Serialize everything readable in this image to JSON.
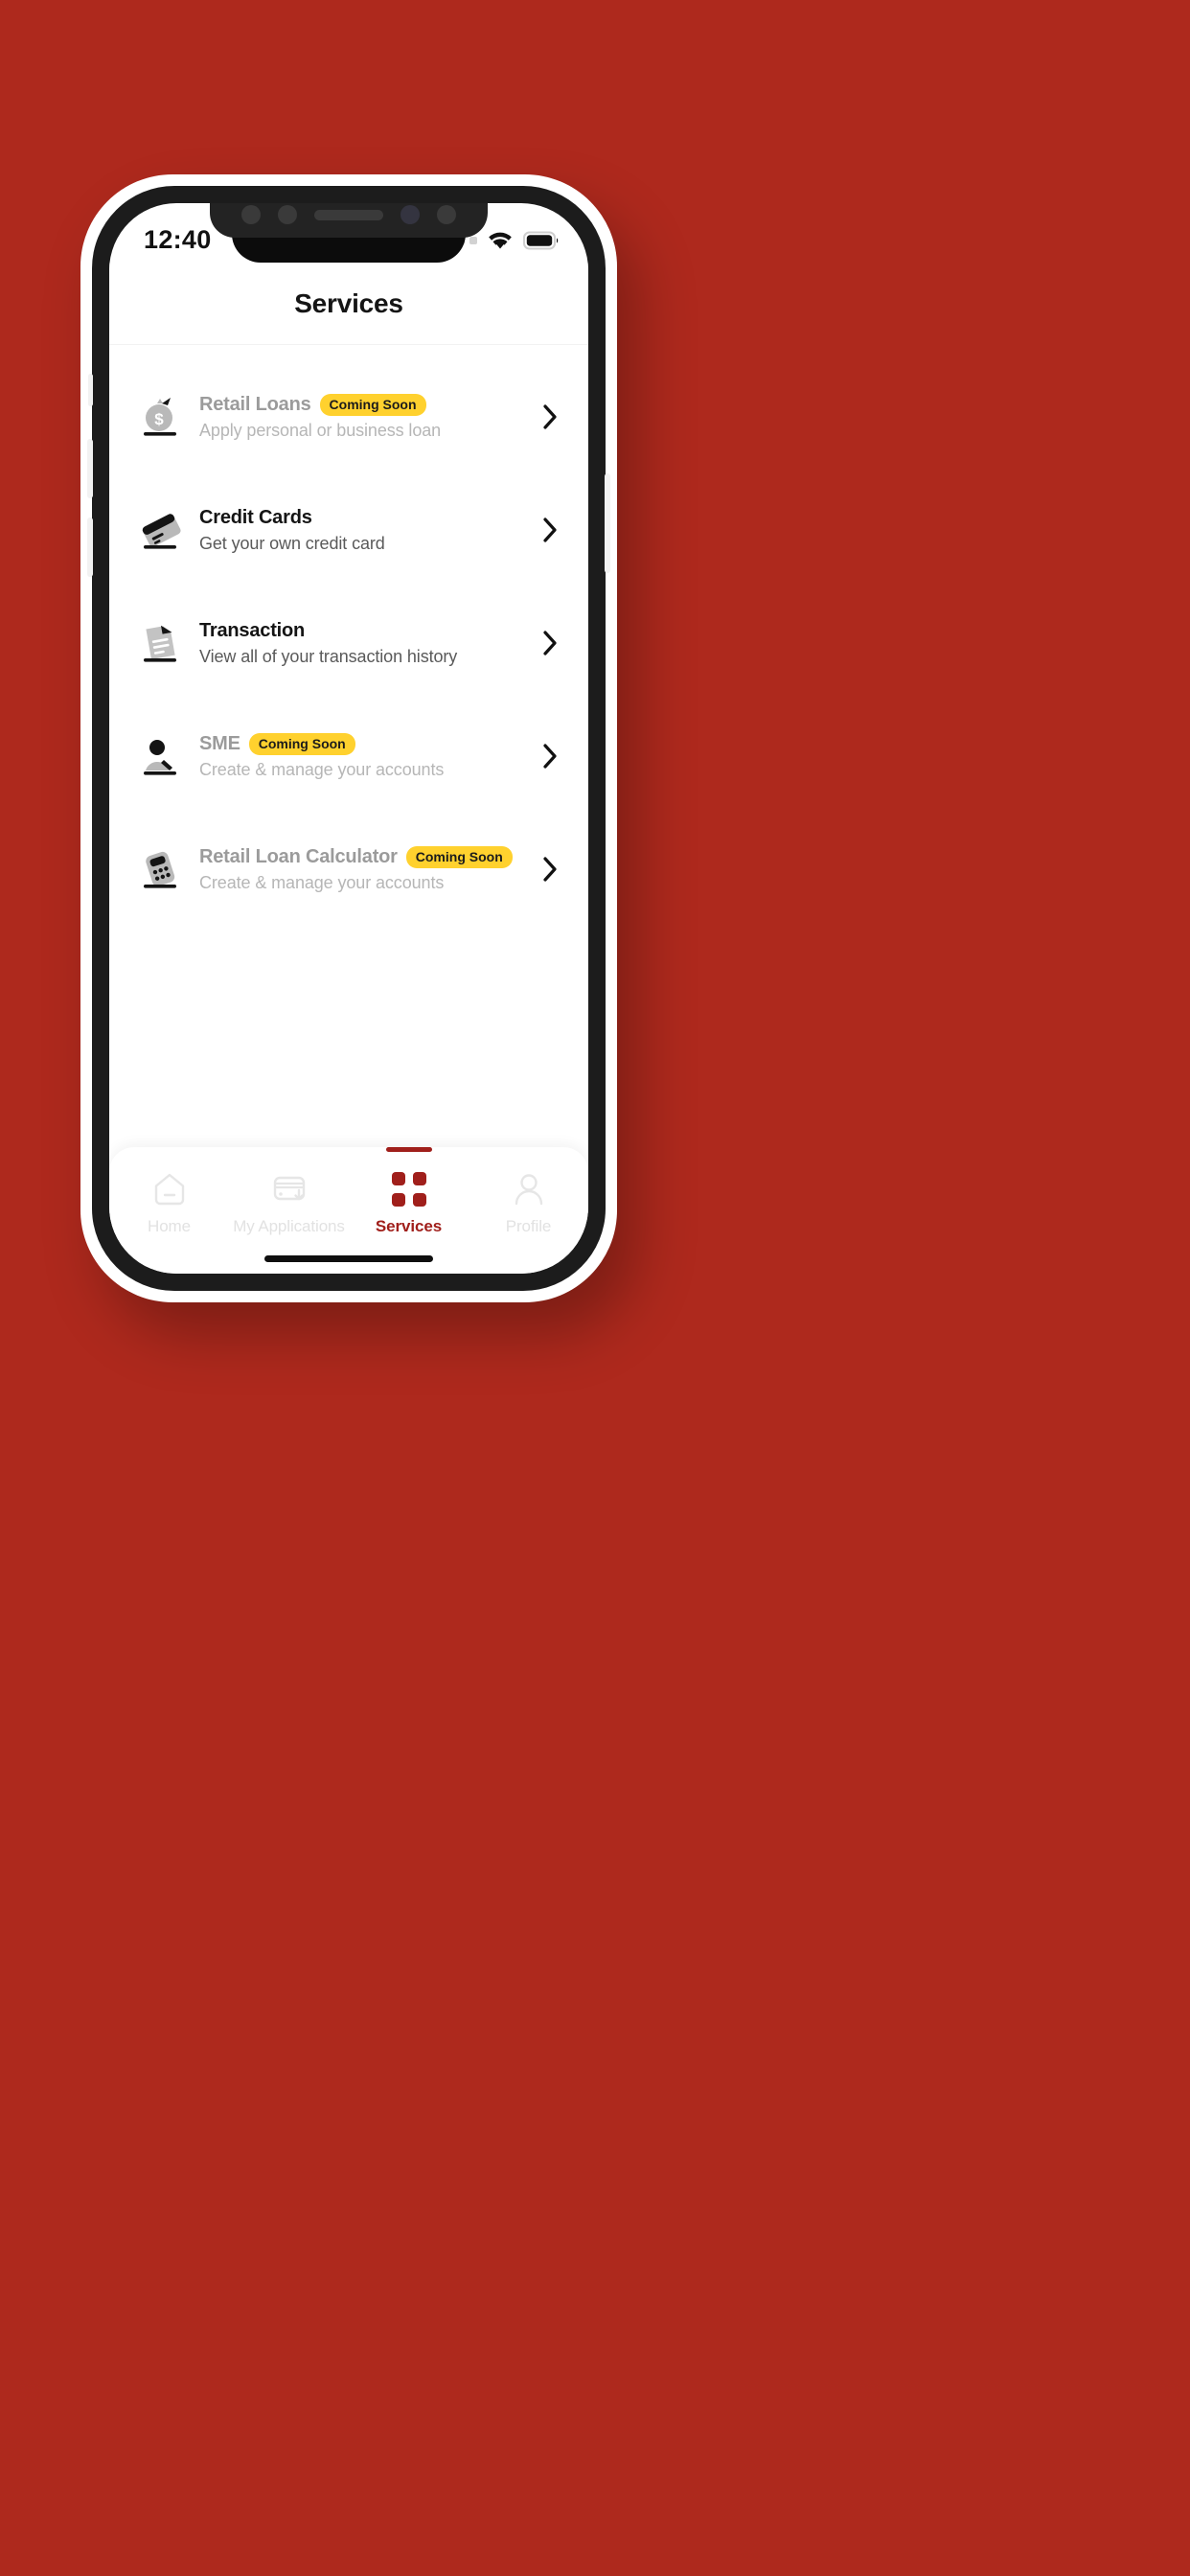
{
  "theme": {
    "background_red": "#AE291D",
    "brand_red": "#A01F1B",
    "badge_yellow": "#FFD12E",
    "muted_text": "#9b9b9b"
  },
  "status_bar": {
    "time": "12:40",
    "signal_icon": "signal-dots-icon",
    "wifi_icon": "wifi-icon",
    "battery_icon": "battery-full-icon"
  },
  "header": {
    "title": "Services"
  },
  "services": [
    {
      "icon": "money-bag-icon",
      "title": "Retail Loans",
      "badge": "Coming Soon",
      "subtitle": "Apply personal or business loan",
      "disabled": true,
      "chevron": "chevron-right-icon"
    },
    {
      "icon": "credit-card-icon",
      "title": "Credit Cards",
      "badge": "",
      "subtitle": "Get your own credit card",
      "disabled": false,
      "chevron": "chevron-right-icon"
    },
    {
      "icon": "document-icon",
      "title": "Transaction",
      "badge": "",
      "subtitle": "View all of your transaction history",
      "disabled": false,
      "chevron": "chevron-right-icon"
    },
    {
      "icon": "person-desk-icon",
      "title": "SME",
      "badge": "Coming Soon",
      "subtitle": "Create & manage your accounts",
      "disabled": true,
      "chevron": "chevron-right-icon"
    },
    {
      "icon": "calculator-icon",
      "title": "Retail Loan Calculator",
      "badge": "Coming Soon",
      "subtitle": "Create & manage your accounts",
      "disabled": true,
      "chevron": "chevron-right-icon"
    }
  ],
  "bottom_nav": {
    "items": [
      {
        "label": "Home",
        "icon": "home-icon",
        "active": false
      },
      {
        "label": "My Applications",
        "icon": "card-download-icon",
        "active": false
      },
      {
        "label": "Services",
        "icon": "grid-dots-icon",
        "active": true
      },
      {
        "label": "Profile",
        "icon": "person-icon",
        "active": false
      }
    ]
  }
}
